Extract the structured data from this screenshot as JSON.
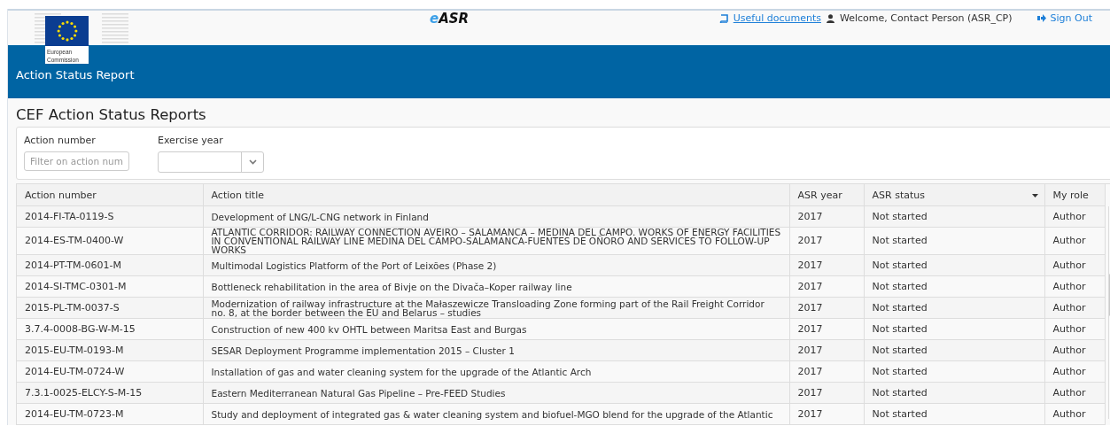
{
  "header": {
    "logo_lines": [
      "European",
      "Commission"
    ],
    "brand": [
      "e",
      "ASR"
    ],
    "links": {
      "documents": "Useful documents",
      "welcome": "Welcome, Contact Person (ASR_CP)",
      "sign_out": "Sign Out"
    },
    "banner_title": "Action Status Report"
  },
  "page_title": "CEF Action Status Reports",
  "filters": [
    {
      "kind": "text",
      "label": "Action number",
      "placeholder": "Filter on action num"
    },
    {
      "kind": "select",
      "label": "Exercise year"
    }
  ],
  "table": {
    "columns": [
      {
        "label": "Action number",
        "sorted": false
      },
      {
        "label": "Action title",
        "sorted": false
      },
      {
        "label": "ASR year",
        "sorted": false
      },
      {
        "label": "ASR status",
        "sorted": true
      },
      {
        "label": "My role",
        "sorted": false
      }
    ],
    "rows": [
      [
        "2014-FI-TA-0119-S",
        "Development of LNG/L-CNG network in Finland",
        "2017",
        "Not started",
        "Author"
      ],
      [
        "2014-ES-TM-0400-W",
        "ATLANTIC CORRIDOR: RAILWAY CONNECTION AVEIRO – SALAMANCA – MEDINA DEL CAMPO. WORKS OF ENERGY FACILITIES IN CONVENTIONAL RAILWAY LINE MEDINA DEL CAMPO-SALAMANCA-FUENTES DE OÑORO AND SERVICES TO FOLLOW-UP WORKS",
        "2017",
        "Not started",
        "Author"
      ],
      [
        "2014-PT-TM-0601-M",
        "Multimodal Logistics Platform of the Port of Leixões (Phase 2)",
        "2017",
        "Not started",
        "Author"
      ],
      [
        "2014-SI-TMC-0301-M",
        "Bottleneck rehabilitation in the area of Bivje on the Divača–Koper railway line",
        "2017",
        "Not started",
        "Author"
      ],
      [
        "2015-PL-TM-0037-S",
        "Modernization of railway infrastructure at the Małaszewicze Transloading Zone forming part of the Rail Freight Corridor no. 8, at the border between the EU and Belarus – studies",
        "2017",
        "Not started",
        "Author"
      ],
      [
        "3.7.4-0008-BG-W-M-15",
        "Construction of new 400 kv OHTL between Maritsa East and Burgas",
        "2017",
        "Not started",
        "Author"
      ],
      [
        "2015-EU-TM-0193-M",
        "SESAR Deployment Programme implementation 2015 – Cluster 1",
        "2017",
        "Not started",
        "Author"
      ],
      [
        "2014-EU-TM-0724-W",
        "Installation of gas and water cleaning system for the upgrade of the Atlantic Arch",
        "2017",
        "Not started",
        "Author"
      ],
      [
        "7.3.1-0025-ELCY-S-M-15",
        "Eastern Mediterranean Natural Gas Pipeline – Pre-FEED Studies",
        "2017",
        "Not started",
        "Author"
      ],
      [
        "2014-EU-TM-0723-M",
        "Study and deployment of integrated gas & water cleaning system and biofuel-MGO blend for the upgrade of the Atlantic",
        "2017",
        "Not started",
        "Author"
      ]
    ]
  }
}
